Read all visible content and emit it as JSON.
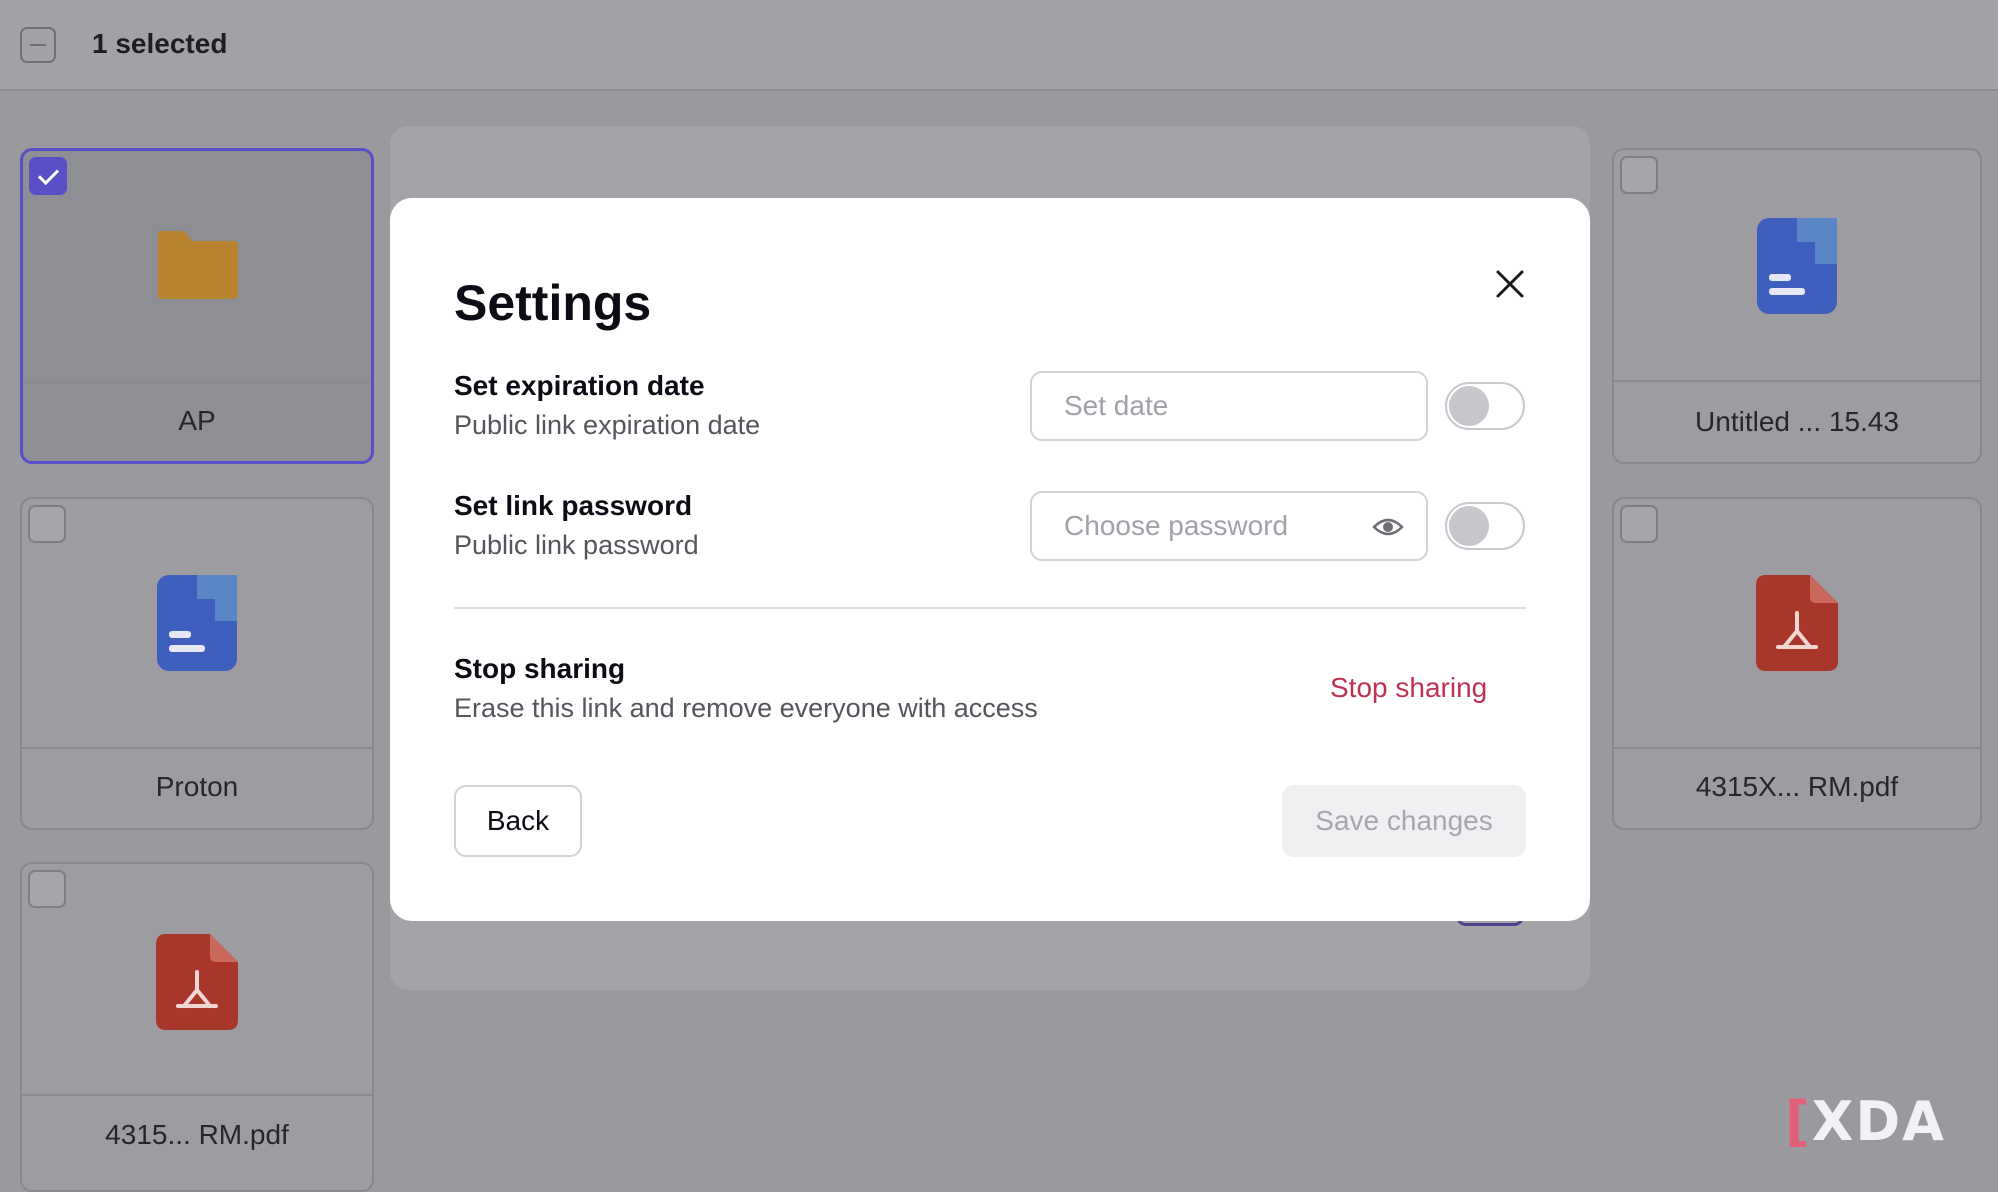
{
  "toolbar": {
    "selected_label": "1 selected"
  },
  "files": [
    {
      "name": "AP",
      "type": "folder",
      "selected": true
    },
    {
      "name": "Untitled ... 15.43",
      "type": "document",
      "selected": false
    },
    {
      "name": "Proton",
      "type": "document",
      "selected": false
    },
    {
      "name": "4315X... RM.pdf",
      "type": "pdf",
      "selected": false
    },
    {
      "name": "4315... RM.pdf",
      "type": "pdf",
      "selected": false
    }
  ],
  "modal": {
    "title": "Settings",
    "expiration": {
      "title": "Set expiration date",
      "subtitle": "Public link expiration date",
      "placeholder": "Set date",
      "enabled": false
    },
    "password": {
      "title": "Set link password",
      "subtitle": "Public link password",
      "placeholder": "Choose password",
      "enabled": false
    },
    "stop_sharing": {
      "title": "Stop sharing",
      "subtitle": "Erase this link and remove everyone with access",
      "action_label": "Stop sharing"
    },
    "back_label": "Back",
    "save_label": "Save changes"
  },
  "colors": {
    "accent": "#5a4fc6",
    "danger": "#c0314f",
    "folder": "#d6962c",
    "doc": "#4c6bd6",
    "pdf": "#c2362c"
  },
  "watermark": "XDA"
}
